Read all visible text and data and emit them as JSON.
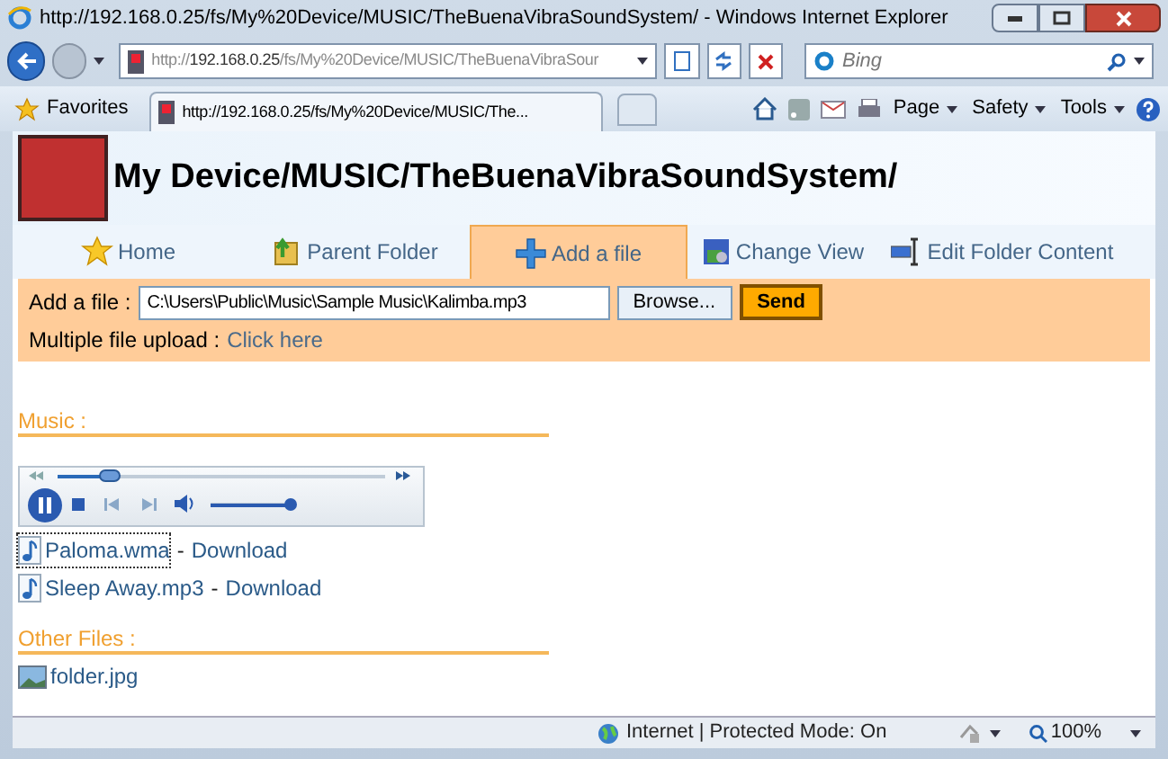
{
  "window": {
    "title": "http://192.168.0.25/fs/My%20Device/MUSIC/TheBuenaVibraSoundSystem/ - Windows Internet Explorer"
  },
  "address_bar": {
    "url": "http://**192.168.0.25**/fs/My%20Device/MUSIC/TheBuenaVibraSour",
    "search_placeholder": "Bing"
  },
  "command_bar": {
    "favorites": "Favorites",
    "tab_title": "http://192.168.0.25/fs/My%20Device/MUSIC/The...",
    "menus": [
      "Page",
      "Safety",
      "Tools"
    ]
  },
  "page": {
    "heading": "My Device/MUSIC/TheBuenaVibraSoundSystem/",
    "nav": [
      {
        "kind": "home",
        "label": "Home",
        "selected": false
      },
      {
        "kind": "parent",
        "label": "Parent Folder",
        "selected": false
      },
      {
        "kind": "add",
        "label": "Add a file",
        "selected": true
      },
      {
        "kind": "view",
        "label": "Change View",
        "selected": false
      },
      {
        "kind": "edit",
        "label": "Edit Folder Content",
        "selected": false
      }
    ],
    "add_form": {
      "label": "Add a file :",
      "file_value": "C:\\Users\\Public\\Music\\Sample Music\\Kalimba.mp3",
      "browse": "Browse...",
      "send": "Send",
      "multiple_label": "Multiple file upload :",
      "multiple_link": "Click here"
    },
    "sections": [
      {
        "title": "Music :",
        "player": {
          "seek": {
            "level": 0.16
          },
          "volume": {
            "level": 0.95
          }
        },
        "files": [
          {
            "kind": "audio",
            "name": "Paloma.wma",
            "separator": "-",
            "download": "Download",
            "selected": true
          },
          {
            "kind": "audio",
            "name": "Sleep Away.mp3",
            "separator": "-",
            "download": "Download",
            "selected": false
          }
        ]
      },
      {
        "title": "Other Files :",
        "files": [
          {
            "kind": "image",
            "name": "folder.jpg",
            "selected": false
          }
        ]
      }
    ]
  },
  "status_bar": {
    "zone": "Internet | Protected Mode: On",
    "zoom": "100%"
  }
}
